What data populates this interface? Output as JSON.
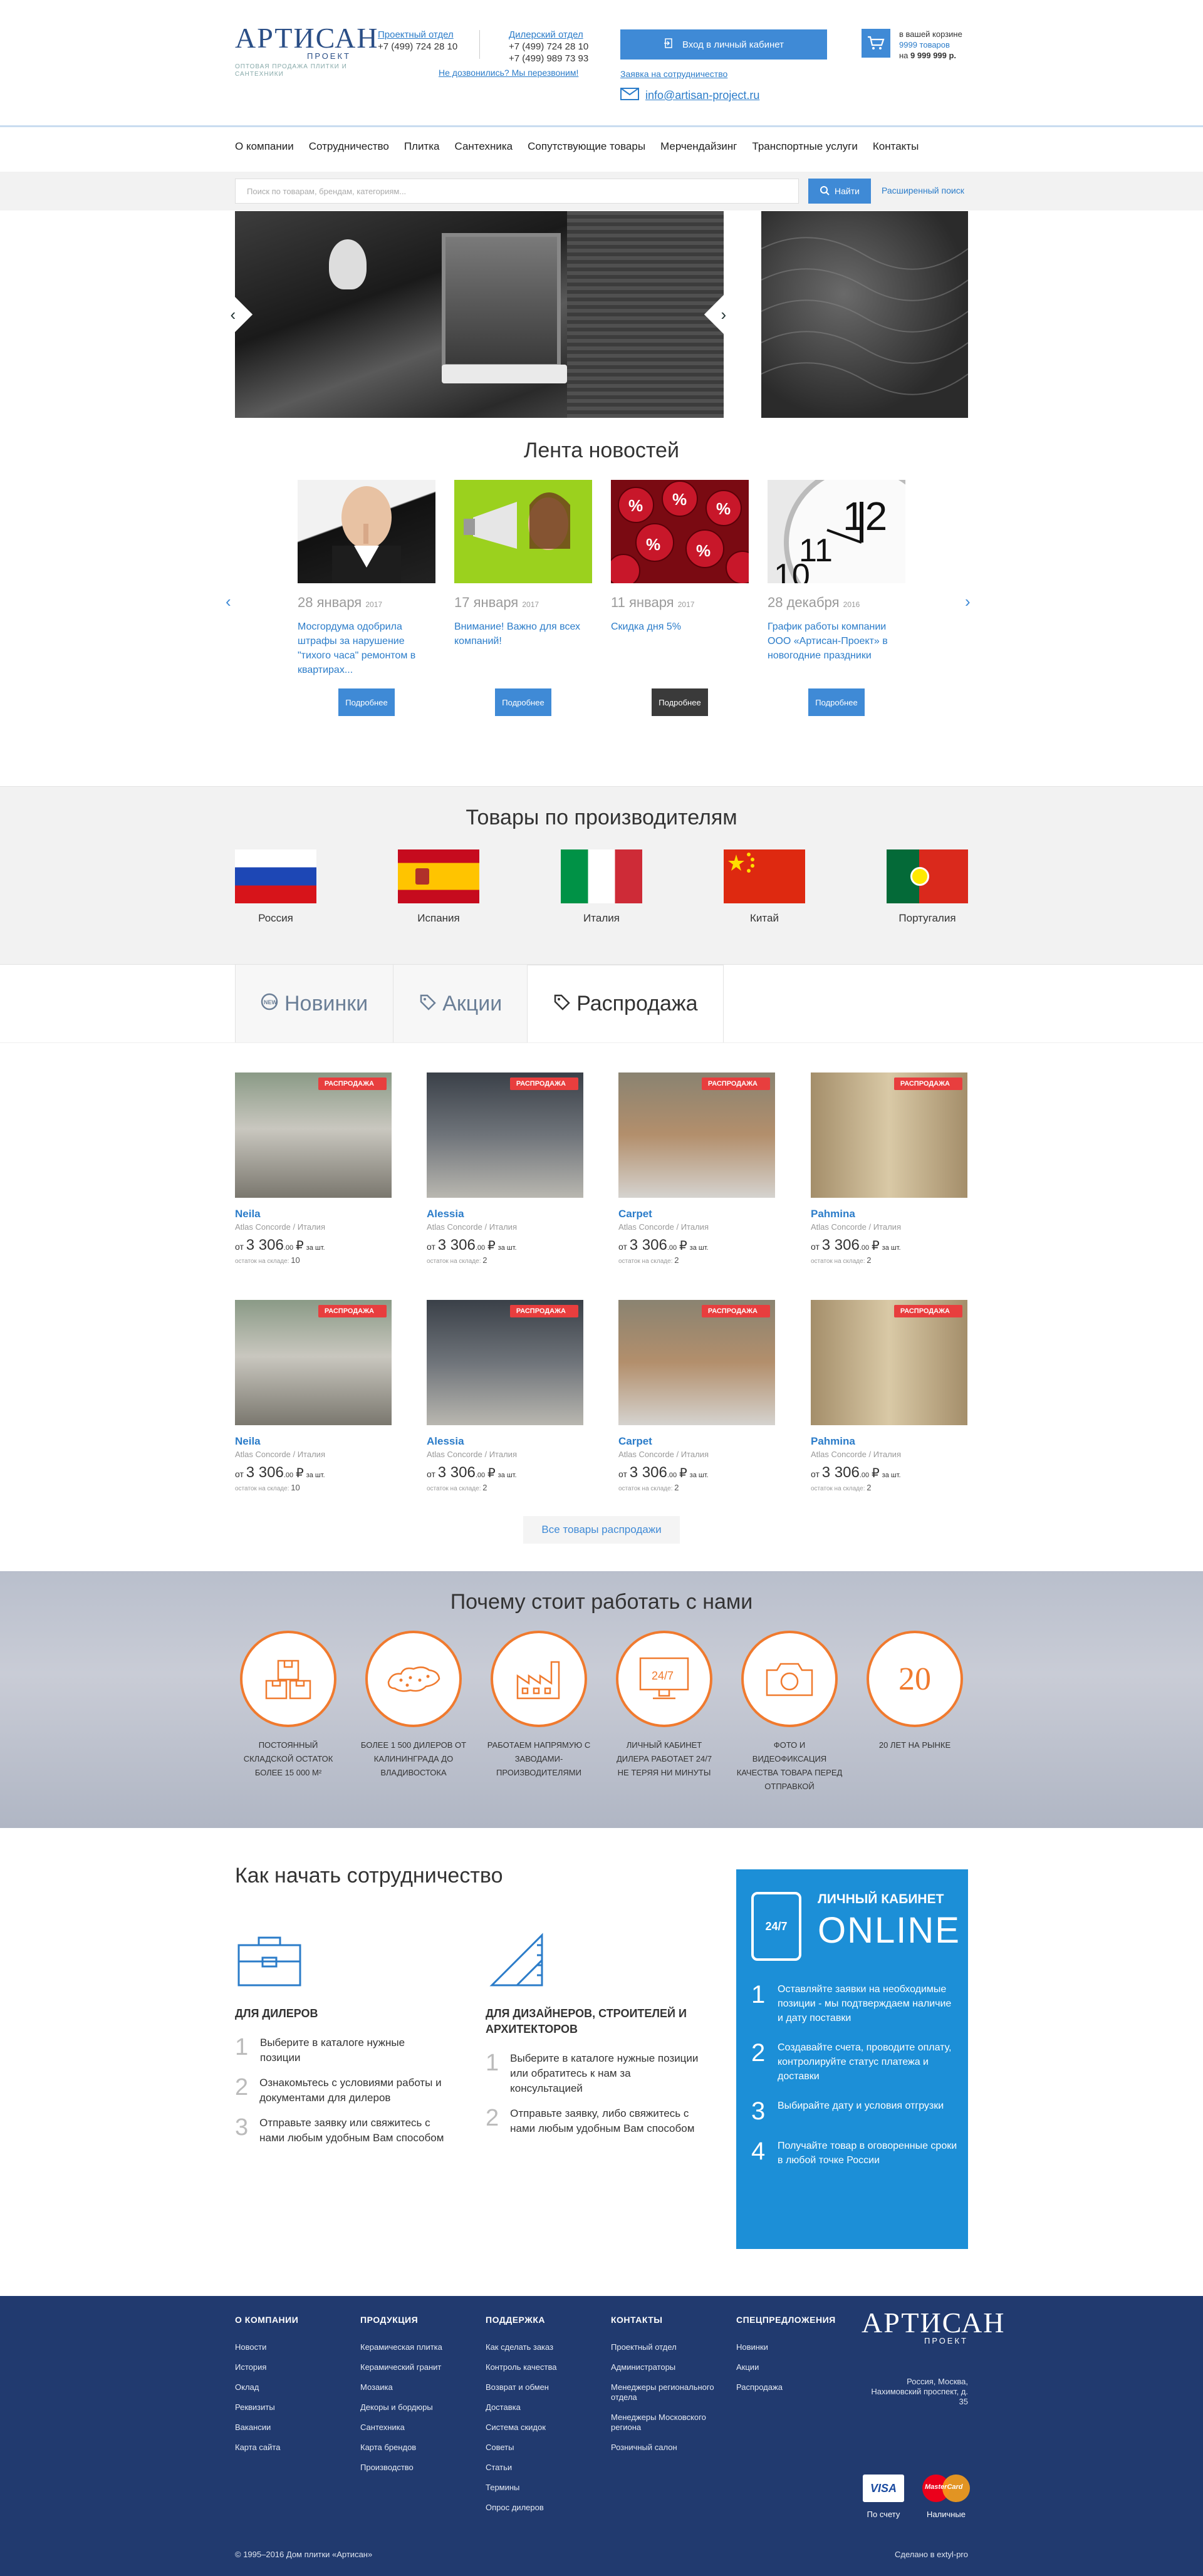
{
  "header": {
    "logo_main": "АРТИСАН",
    "logo_sub": "ПРОЕКТ",
    "logo_tagline": "ОПТОВАЯ ПРОДАЖА ПЛИТКИ И САНТЕХНИКИ",
    "phone_block_1": {
      "label": "Проектный отдел",
      "phones": [
        "+7 (499) 724 28 10"
      ]
    },
    "phone_block_2": {
      "label": "Дилерский отдел",
      "phones": [
        "+7 (499) 724 28 10",
        "+7 (499) 989 73 93"
      ]
    },
    "callback_link": "Не дозвонились? Мы перезвоним!",
    "login_button": "Вход в личный кабинет",
    "partner_link": "Заявка на сотрудничество",
    "email": "info@artisan-project.ru",
    "cart": {
      "line1": "в вашей корзине",
      "count": "9999 товаров",
      "sum_prefix": "на",
      "sum": "9 999 999 р."
    }
  },
  "nav": [
    "О компании",
    "Сотрудничество",
    "Плитка",
    "Сантехника",
    "Сопутствующие товары",
    "Мерчендайзинг",
    "Транспортные услуги",
    "Контакты"
  ],
  "search": {
    "placeholder": "Поиск по товарам, брендам, категориям...",
    "button": "Найти",
    "advanced": "Расширенный поиск"
  },
  "news": {
    "title": "Лента новостей",
    "items": [
      {
        "date": "28 января",
        "year": "2017",
        "text": "Мосгордума одобрила штрафы за нарушение \"тихого часа\" ремонтом в квартирах...",
        "button": "Подробнее"
      },
      {
        "date": "17 января",
        "year": "2017",
        "text": "Внимание! Важно для всех компаний!",
        "button": "Подробнее"
      },
      {
        "date": "11 января",
        "year": "2017",
        "text": "Скидка дня 5%",
        "button": "Подробнее"
      },
      {
        "date": "28 декабря",
        "year": "2016",
        "text": "График работы компании ООО «Артисан-Проект» в новогодние праздники",
        "button": "Подробнее"
      }
    ]
  },
  "producers": {
    "title": "Товары по производителям",
    "items": [
      "Россия",
      "Испания",
      "Италия",
      "Китай",
      "Португалия"
    ]
  },
  "tabs": [
    "Новинки",
    "Акции",
    "Распродажа"
  ],
  "products": {
    "badge": "РАСПРОДАЖА",
    "price_prefix": "от",
    "price_int": "3 306",
    "price_frac": ".00",
    "currency": "₽",
    "per": "за шт.",
    "stock_label": "остаток на складе:",
    "items": [
      {
        "name": "Neila",
        "brand": "Atlas Concorde / Италия",
        "stock": "10"
      },
      {
        "name": "Alessia",
        "brand": "Atlas Concorde / Италия",
        "stock": "2"
      },
      {
        "name": "Carpet",
        "brand": "Atlas Concorde / Италия",
        "stock": "2"
      },
      {
        "name": "Pahmina",
        "brand": "Atlas Concorde / Италия",
        "stock": "2"
      },
      {
        "name": "Neila",
        "brand": "Atlas Concorde / Италия",
        "stock": "10"
      },
      {
        "name": "Alessia",
        "brand": "Atlas Concorde / Италия",
        "stock": "2"
      },
      {
        "name": "Carpet",
        "brand": "Atlas Concorde / Италия",
        "stock": "2"
      },
      {
        "name": "Pahmina",
        "brand": "Atlas Concorde / Италия",
        "stock": "2"
      }
    ],
    "all_button": "Все товары распродажи"
  },
  "why": {
    "title": "Почему стоит работать с нами",
    "items": [
      {
        "label": "Постоянный складской остаток более 15 000 м²",
        "icon": "boxes-icon"
      },
      {
        "label": "Более 1 500 дилеров от Калининграда до Владивостока",
        "icon": "map-icon"
      },
      {
        "label": "Работаем напрямую с заводами-производителями",
        "icon": "factory-icon"
      },
      {
        "label": "Личный кабинет дилера работает 24/7 не теряя ни минуты",
        "icon": "monitor-24-icon",
        "glyph": "24/7"
      },
      {
        "label": "Фото и видеофиксация качества товара перед отправкой",
        "icon": "camera-icon"
      },
      {
        "label": "20 лет на рынке",
        "icon": "twenty-years-icon",
        "glyph": "20"
      }
    ]
  },
  "coop": {
    "title": "Как начать сотрудничество",
    "dealers": {
      "heading": "Для дилеров",
      "steps": [
        "Выберите в каталоге нужные позиции",
        "Ознакомьтесь с условиями работы и документами для дилеров",
        "Отправьте заявку или свяжитесь с нами любым удобным Вам способом"
      ]
    },
    "designers": {
      "heading": "Для дизайнеров, строителей и архитекторов",
      "steps": [
        "Выберите в каталоге нужные позиции или обратитесь к нам за консультацией",
        "Отправьте заявку, либо свяжитесь с нами любым удобным Вам способом"
      ]
    }
  },
  "cabinet": {
    "heading1": "ЛИЧНЫЙ КАБИНЕТ",
    "heading2": "ONLINE",
    "phone_label": "24/7",
    "steps": [
      "Оставляйте заявки на необходимые позиции - мы подтверждаем наличие и дату поставки",
      "Создавайте счета, проводите оплату, контролируйте статус платежа и доставки",
      "Выбирайте дату и условия отгрузки",
      "Получайте товар в оговоренные сроки в любой точке России"
    ]
  },
  "footer": {
    "cols": [
      {
        "title": "О КОМПАНИИ",
        "items": [
          "Новости",
          "История",
          "Оклад",
          "Реквизиты",
          "Вакансии",
          "Карта сайта"
        ]
      },
      {
        "title": "ПРОДУКЦИЯ",
        "items": [
          "Керамическая плитка",
          "Керамический гранит",
          "Мозаика",
          "Декоры и бордюры",
          "Сантехника",
          "Карта брендов",
          "Производство"
        ]
      },
      {
        "title": "ПОДДЕРЖКА",
        "items": [
          "Как сделать заказ",
          "Контроль качества",
          "Возврат и обмен",
          "Доставка",
          "Система скидок",
          "Советы",
          "Статьи",
          "Термины",
          "Опрос дилеров"
        ]
      },
      {
        "title": "КОНТАКТЫ",
        "items": [
          "Проектный отдел",
          "Администраторы",
          "Менеджеры регионального отдела",
          "Менеджеры Московского региона",
          "Розничный салон"
        ]
      },
      {
        "title": "СПЕЦПРЕДЛОЖЕНИЯ",
        "items": [
          "Новинки",
          "Акции",
          "Распродажа"
        ]
      }
    ],
    "address": "Россия, Москва, Нахимовский проспект, д. 35",
    "pay_visa": "VISA",
    "pay_mc": "MasterCard",
    "pay_invoice": "По счету",
    "pay_cash": "Наличные",
    "copyright": "© 1995–2016 Дом плитки «Артисан»",
    "developer": "Сделано в extyl-pro"
  },
  "colors": {
    "accent": "#3f8ad6",
    "link": "#2b7cc9",
    "sale": "#e83e3e",
    "orange": "#f07a2e",
    "footer": "#213a6f",
    "cabinet": "#1c8fd7"
  }
}
